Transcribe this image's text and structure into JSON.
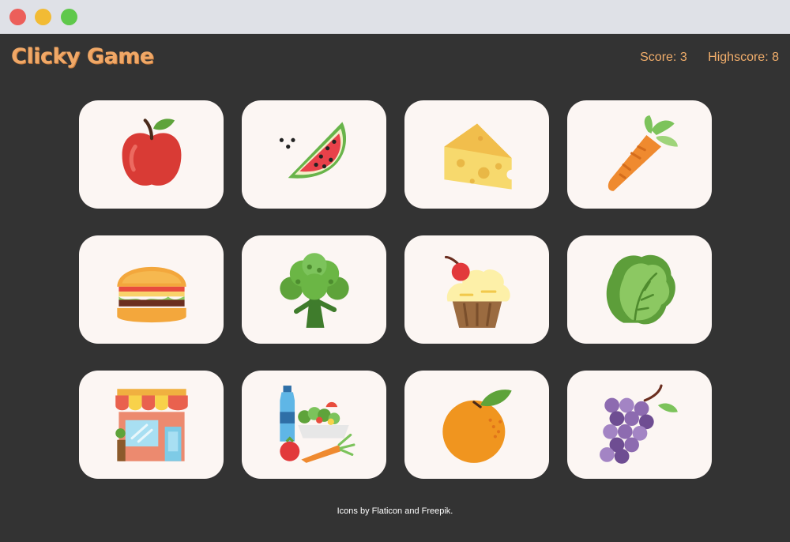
{
  "window": {
    "controls": [
      "close",
      "minimize",
      "maximize"
    ]
  },
  "header": {
    "title": "Clicky Game",
    "score_text": "Score: 3",
    "highscore_text": "Highscore: 8"
  },
  "cards": [
    {
      "icon": "apple-icon"
    },
    {
      "icon": "watermelon-icon"
    },
    {
      "icon": "cheese-icon"
    },
    {
      "icon": "carrot-icon"
    },
    {
      "icon": "burger-icon"
    },
    {
      "icon": "broccoli-icon"
    },
    {
      "icon": "cupcake-icon"
    },
    {
      "icon": "lettuce-icon"
    },
    {
      "icon": "shop-icon"
    },
    {
      "icon": "groceries-icon"
    },
    {
      "icon": "orange-icon"
    },
    {
      "icon": "grapes-icon"
    }
  ],
  "footer": {
    "credit": "Icons by Flaticon and Freepik."
  },
  "colors": {
    "background": "#333333",
    "accent": "#f0a867",
    "card": "#fcf6f3"
  }
}
